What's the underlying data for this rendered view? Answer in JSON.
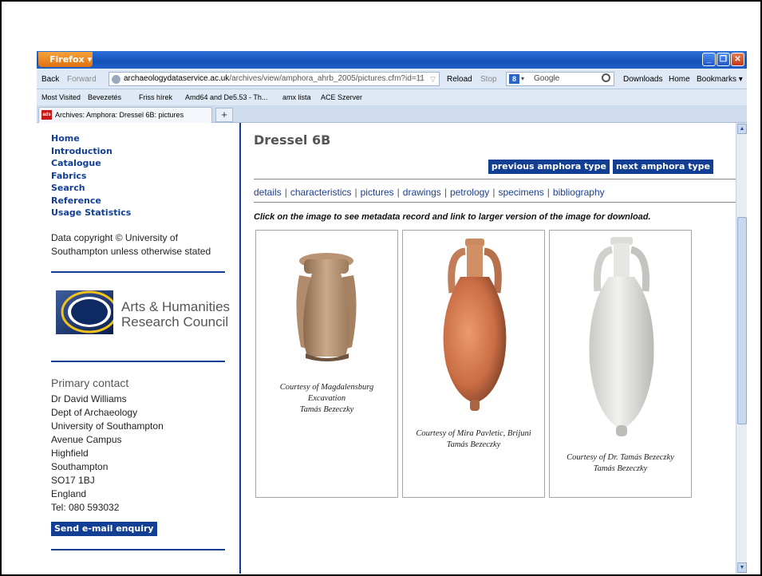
{
  "browser": {
    "firefox_button": "Firefox",
    "nav": {
      "back": "Back",
      "forward": "Forward",
      "reload": "Reload",
      "stop": "Stop"
    },
    "url_domain": "archaeologydataservice.ac.uk",
    "url_path": "/archives/view/amphora_ahrb_2005/pictures.cfm?id=11",
    "search_placeholder": "Google",
    "right_items": {
      "downloads": "Downloads",
      "home": "Home",
      "bookmarks": "Bookmarks"
    },
    "bookmarks": [
      "Most Visited",
      "Bevezetés",
      "Friss hírek",
      "Amd64 and De5.53 - Th...",
      "amx lista",
      "ACE Szerver"
    ],
    "tab_title": "Archives: Amphora: Dressel 6B: pictures",
    "new_tab": "+"
  },
  "sidebar": {
    "nav": [
      "Home",
      "Introduction",
      "Catalogue",
      "Fabrics",
      "Search",
      "Reference",
      "Usage Statistics"
    ],
    "copyright_line1": "Data copyright © University of",
    "copyright_line2": "Southampton unless otherwise stated",
    "ahrc_line1": "Arts & Humanities",
    "ahrc_line2": "Research Council",
    "contact_heading": "Primary contact",
    "contact_lines": [
      "Dr David Williams",
      "Dept of Archaeology",
      "University of Southampton",
      "Avenue Campus",
      "Highfield",
      "Southampton",
      "SO17 1BJ",
      "England",
      "Tel: 080 593032"
    ],
    "email_button": "Send e-mail enquiry"
  },
  "main": {
    "title": "Dressel 6B",
    "prev_button": "previous amphora type",
    "next_button": "next amphora type",
    "tabs": [
      "details",
      "characteristics",
      "pictures",
      "drawings",
      "petrology",
      "specimens",
      "bibliography"
    ],
    "instructions": "Click on the image to see metadata record and link to larger version of the image for download.",
    "images": [
      {
        "caption_lines": [
          "Courtesy of Magdalensburg",
          "Excavation",
          "Tamás Bezeczky"
        ]
      },
      {
        "caption_lines": [
          "Courtesy of Mira Pavletic, Brijuni",
          "Tamás Bezeczky"
        ]
      },
      {
        "caption_lines": [
          "Courtesy of Dr. Tamás Bezeczky",
          "Tamás Bezeczky"
        ]
      }
    ]
  },
  "colors": {
    "link_blue": "#123f94",
    "titlebar": "#1d5fc8",
    "firefox_orange": "#e0700f"
  }
}
